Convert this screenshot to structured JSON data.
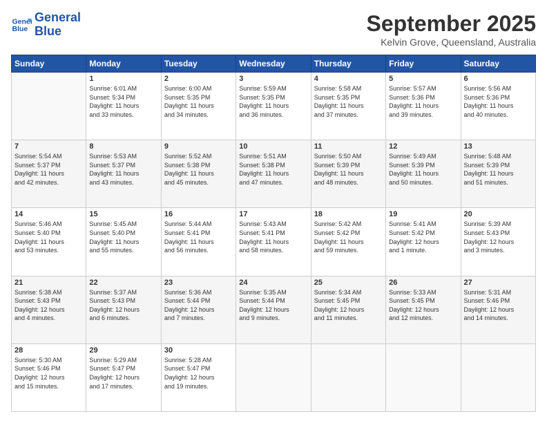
{
  "header": {
    "logo_line1": "General",
    "logo_line2": "Blue",
    "month_title": "September 2025",
    "location": "Kelvin Grove, Queensland, Australia"
  },
  "days_of_week": [
    "Sunday",
    "Monday",
    "Tuesday",
    "Wednesday",
    "Thursday",
    "Friday",
    "Saturday"
  ],
  "weeks": [
    [
      {
        "day": "",
        "info": ""
      },
      {
        "day": "1",
        "info": "Sunrise: 6:01 AM\nSunset: 5:34 PM\nDaylight: 11 hours\nand 33 minutes."
      },
      {
        "day": "2",
        "info": "Sunrise: 6:00 AM\nSunset: 5:35 PM\nDaylight: 11 hours\nand 34 minutes."
      },
      {
        "day": "3",
        "info": "Sunrise: 5:59 AM\nSunset: 5:35 PM\nDaylight: 11 hours\nand 36 minutes."
      },
      {
        "day": "4",
        "info": "Sunrise: 5:58 AM\nSunset: 5:35 PM\nDaylight: 11 hours\nand 37 minutes."
      },
      {
        "day": "5",
        "info": "Sunrise: 5:57 AM\nSunset: 5:36 PM\nDaylight: 11 hours\nand 39 minutes."
      },
      {
        "day": "6",
        "info": "Sunrise: 5:56 AM\nSunset: 5:36 PM\nDaylight: 11 hours\nand 40 minutes."
      }
    ],
    [
      {
        "day": "7",
        "info": "Sunrise: 5:54 AM\nSunset: 5:37 PM\nDaylight: 11 hours\nand 42 minutes."
      },
      {
        "day": "8",
        "info": "Sunrise: 5:53 AM\nSunset: 5:37 PM\nDaylight: 11 hours\nand 43 minutes."
      },
      {
        "day": "9",
        "info": "Sunrise: 5:52 AM\nSunset: 5:38 PM\nDaylight: 11 hours\nand 45 minutes."
      },
      {
        "day": "10",
        "info": "Sunrise: 5:51 AM\nSunset: 5:38 PM\nDaylight: 11 hours\nand 47 minutes."
      },
      {
        "day": "11",
        "info": "Sunrise: 5:50 AM\nSunset: 5:39 PM\nDaylight: 11 hours\nand 48 minutes."
      },
      {
        "day": "12",
        "info": "Sunrise: 5:49 AM\nSunset: 5:39 PM\nDaylight: 11 hours\nand 50 minutes."
      },
      {
        "day": "13",
        "info": "Sunrise: 5:48 AM\nSunset: 5:39 PM\nDaylight: 11 hours\nand 51 minutes."
      }
    ],
    [
      {
        "day": "14",
        "info": "Sunrise: 5:46 AM\nSunset: 5:40 PM\nDaylight: 11 hours\nand 53 minutes."
      },
      {
        "day": "15",
        "info": "Sunrise: 5:45 AM\nSunset: 5:40 PM\nDaylight: 11 hours\nand 55 minutes."
      },
      {
        "day": "16",
        "info": "Sunrise: 5:44 AM\nSunset: 5:41 PM\nDaylight: 11 hours\nand 56 minutes."
      },
      {
        "day": "17",
        "info": "Sunrise: 5:43 AM\nSunset: 5:41 PM\nDaylight: 11 hours\nand 58 minutes."
      },
      {
        "day": "18",
        "info": "Sunrise: 5:42 AM\nSunset: 5:42 PM\nDaylight: 11 hours\nand 59 minutes."
      },
      {
        "day": "19",
        "info": "Sunrise: 5:41 AM\nSunset: 5:42 PM\nDaylight: 12 hours\nand 1 minute."
      },
      {
        "day": "20",
        "info": "Sunrise: 5:39 AM\nSunset: 5:43 PM\nDaylight: 12 hours\nand 3 minutes."
      }
    ],
    [
      {
        "day": "21",
        "info": "Sunrise: 5:38 AM\nSunset: 5:43 PM\nDaylight: 12 hours\nand 4 minutes."
      },
      {
        "day": "22",
        "info": "Sunrise: 5:37 AM\nSunset: 5:43 PM\nDaylight: 12 hours\nand 6 minutes."
      },
      {
        "day": "23",
        "info": "Sunrise: 5:36 AM\nSunset: 5:44 PM\nDaylight: 12 hours\nand 7 minutes."
      },
      {
        "day": "24",
        "info": "Sunrise: 5:35 AM\nSunset: 5:44 PM\nDaylight: 12 hours\nand 9 minutes."
      },
      {
        "day": "25",
        "info": "Sunrise: 5:34 AM\nSunset: 5:45 PM\nDaylight: 12 hours\nand 11 minutes."
      },
      {
        "day": "26",
        "info": "Sunrise: 5:33 AM\nSunset: 5:45 PM\nDaylight: 12 hours\nand 12 minutes."
      },
      {
        "day": "27",
        "info": "Sunrise: 5:31 AM\nSunset: 5:46 PM\nDaylight: 12 hours\nand 14 minutes."
      }
    ],
    [
      {
        "day": "28",
        "info": "Sunrise: 5:30 AM\nSunset: 5:46 PM\nDaylight: 12 hours\nand 15 minutes."
      },
      {
        "day": "29",
        "info": "Sunrise: 5:29 AM\nSunset: 5:47 PM\nDaylight: 12 hours\nand 17 minutes."
      },
      {
        "day": "30",
        "info": "Sunrise: 5:28 AM\nSunset: 5:47 PM\nDaylight: 12 hours\nand 19 minutes."
      },
      {
        "day": "",
        "info": ""
      },
      {
        "day": "",
        "info": ""
      },
      {
        "day": "",
        "info": ""
      },
      {
        "day": "",
        "info": ""
      }
    ]
  ]
}
